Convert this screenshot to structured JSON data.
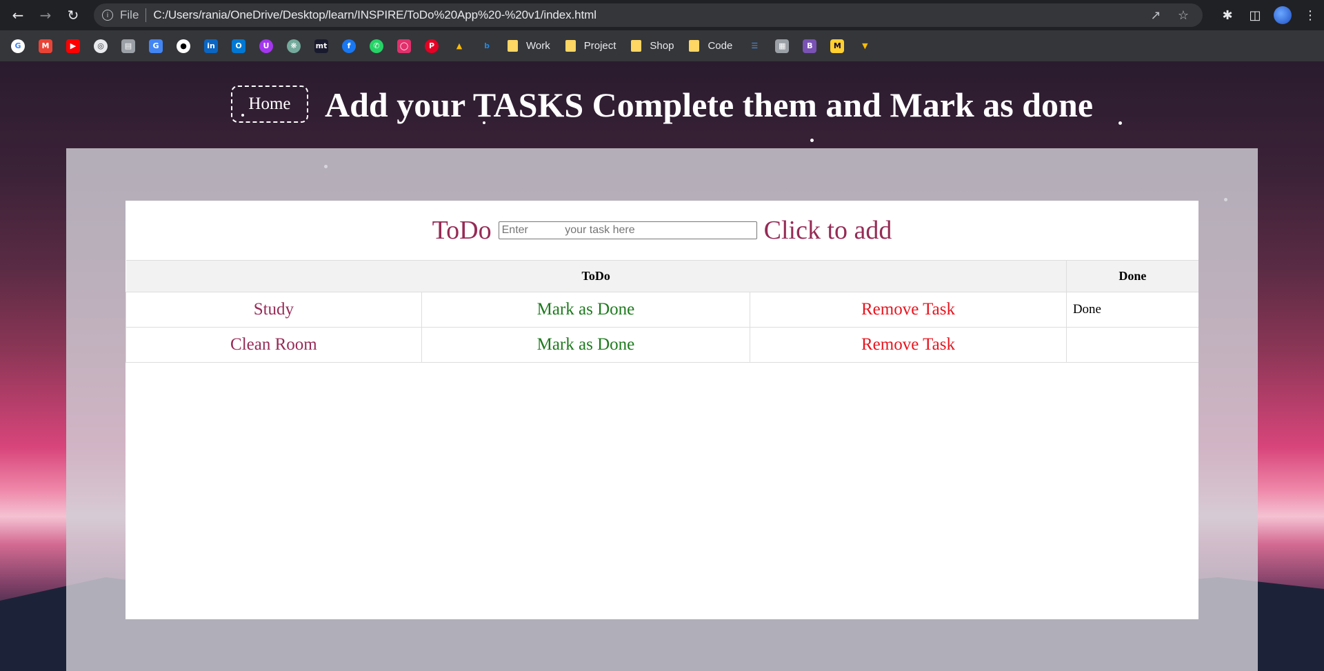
{
  "browser": {
    "url": "C:/Users/rania/OneDrive/Desktop/learn/INSPIRE/ToDo%20App%20-%20v1/index.html",
    "site_label": "File",
    "bookmark_folders": [
      "Work",
      "Project",
      "Shop",
      "Code"
    ]
  },
  "header": {
    "home_label": "Home",
    "title": "Add your TASKS Complete them and Mark as done"
  },
  "form": {
    "label": "ToDo",
    "placeholder": "Enter            your task here",
    "add_label": "Click to add"
  },
  "table": {
    "headers": [
      "ToDo",
      "Done"
    ],
    "rows": [
      {
        "task": "Study",
        "mark": "Mark as Done",
        "remove": "Remove Task",
        "done": "Done"
      },
      {
        "task": "Clean Room",
        "mark": "Mark as Done",
        "remove": "Remove Task",
        "done": ""
      }
    ]
  },
  "colors": {
    "task_text": "#962b56",
    "mark_done": "#1e7a1e",
    "remove": "#e8141e"
  }
}
